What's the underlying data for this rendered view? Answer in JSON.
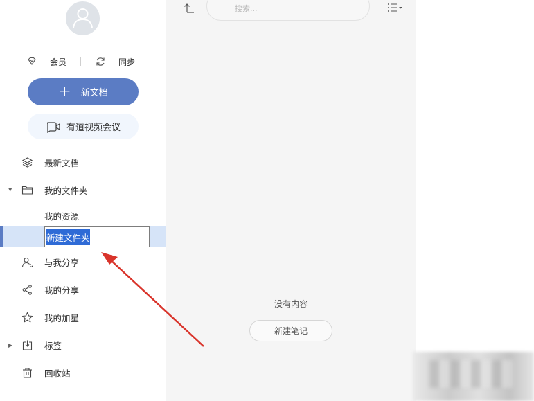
{
  "sidebar": {
    "member_label": "会员",
    "sync_label": "同步",
    "new_doc_label": "新文档",
    "video_meeting_label": "有道视频会议",
    "nav": {
      "latest": "最新文档",
      "my_folders": "我的文件夹",
      "my_resources": "我的资源",
      "rename_value": "新建文件夹",
      "shared_with_me": "与我分享",
      "my_shares": "我的分享",
      "starred": "我的加星",
      "tags": "标签",
      "trash": "回收站"
    }
  },
  "main": {
    "search_placeholder": "搜索...",
    "empty_text": "没有内容",
    "new_note_label": "新建笔记"
  },
  "colors": {
    "accent": "#5b7cc4",
    "selection_bg": "#d6e4f8",
    "text_selection": "#2f6bd6",
    "annotation_arrow": "#d9342b"
  }
}
